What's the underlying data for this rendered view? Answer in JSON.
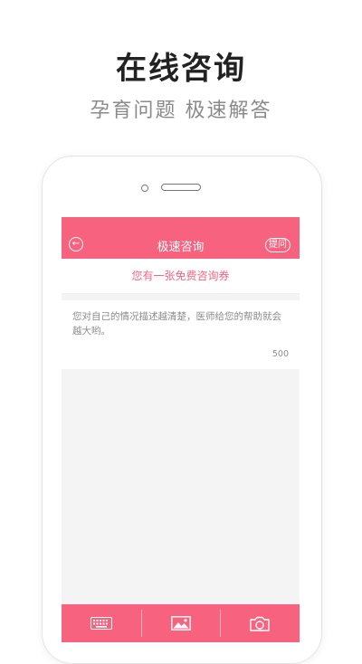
{
  "hero": {
    "title": "在线咨询",
    "subtitle": "孕育问题 极速解答"
  },
  "app": {
    "nav": {
      "title": "极速咨询",
      "ask_label": "提问",
      "back_icon": "back-arrow-icon"
    },
    "coupon_text": "您有一张免费咨询券",
    "question": {
      "placeholder": "您对自己的情况描述越清楚，医师给您的帮助就会越大哟。",
      "char_limit": "500"
    },
    "toolbar": [
      {
        "icon": "keyboard-icon"
      },
      {
        "icon": "image-icon"
      },
      {
        "icon": "camera-icon"
      }
    ]
  },
  "colors": {
    "accent": "#f7627f",
    "coupon_text": "#f06683",
    "screen_bg": "#f4f4f4"
  }
}
